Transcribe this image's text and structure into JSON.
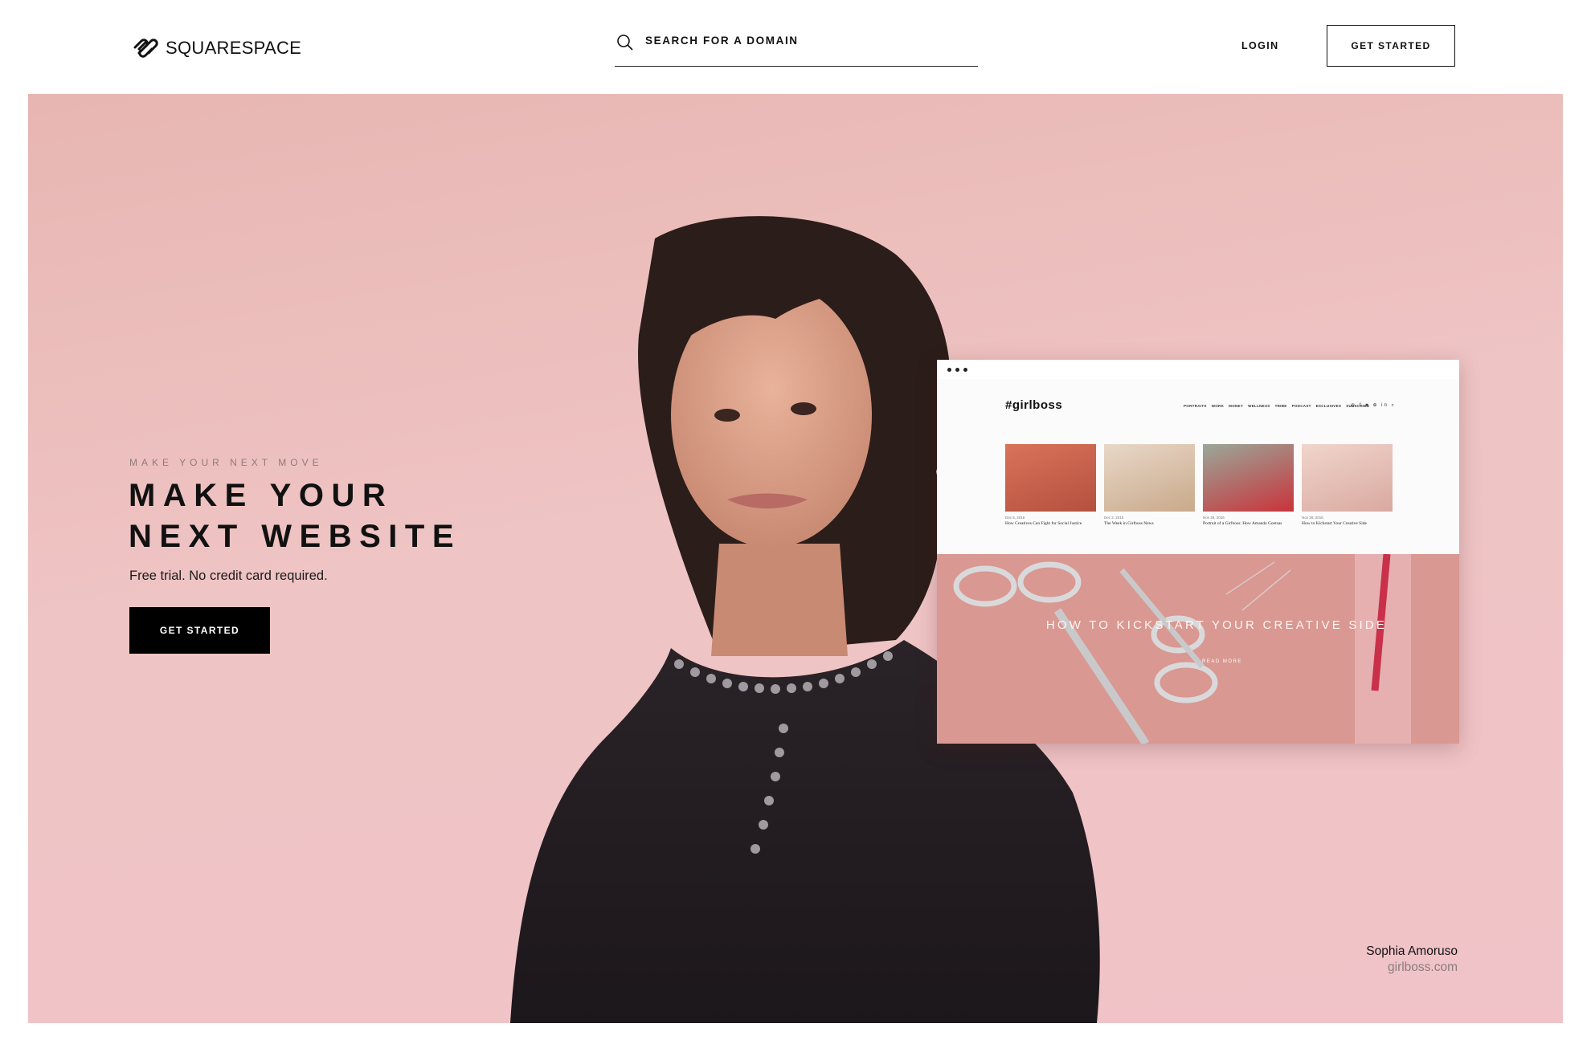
{
  "header": {
    "logo_text": "SQUARESPACE",
    "search_placeholder": "SEARCH FOR A DOMAIN",
    "login_label": "LOGIN",
    "get_started_label": "GET STARTED"
  },
  "hero": {
    "eyebrow": "MAKE YOUR NEXT MOVE",
    "headline": [
      "MAKE YOUR",
      "NEXT WEBSITE"
    ],
    "subline": "Free trial. No credit card required.",
    "cta_label": "GET STARTED",
    "caption_name": "Sophia Amoruso",
    "caption_site": "girlboss.com"
  },
  "mock_site": {
    "logo": "#girlboss",
    "nav": [
      "PORTRAITS",
      "WORK",
      "MONEY",
      "WELLNESS",
      "TRIBE",
      "PODCAST",
      "EXCLUSIVES",
      "SUBSCRIBE"
    ],
    "social": "◎ f ♥ ⊕ in ⌕",
    "posts": [
      {
        "date": "Dec 5, 2016",
        "title": "How Creatives Can Fight for Social Justice"
      },
      {
        "date": "Dec 2, 2016",
        "title": "The Week in Girlboss News"
      },
      {
        "date": "Nov 29, 2016",
        "title": "Portrait of a Girlboss: How Amanda Goetsas"
      },
      {
        "date": "Nov 28, 2016",
        "title": "How to Kickstart Your Creative Side"
      }
    ],
    "feature_title": "HOW TO KICKSTART YOUR CREATIVE SIDE",
    "feature_link": "READ MORE"
  },
  "colors": {
    "hero_pink": "#efc4c4",
    "accent": "#000000",
    "caption_gray": "#8a7d7d"
  }
}
